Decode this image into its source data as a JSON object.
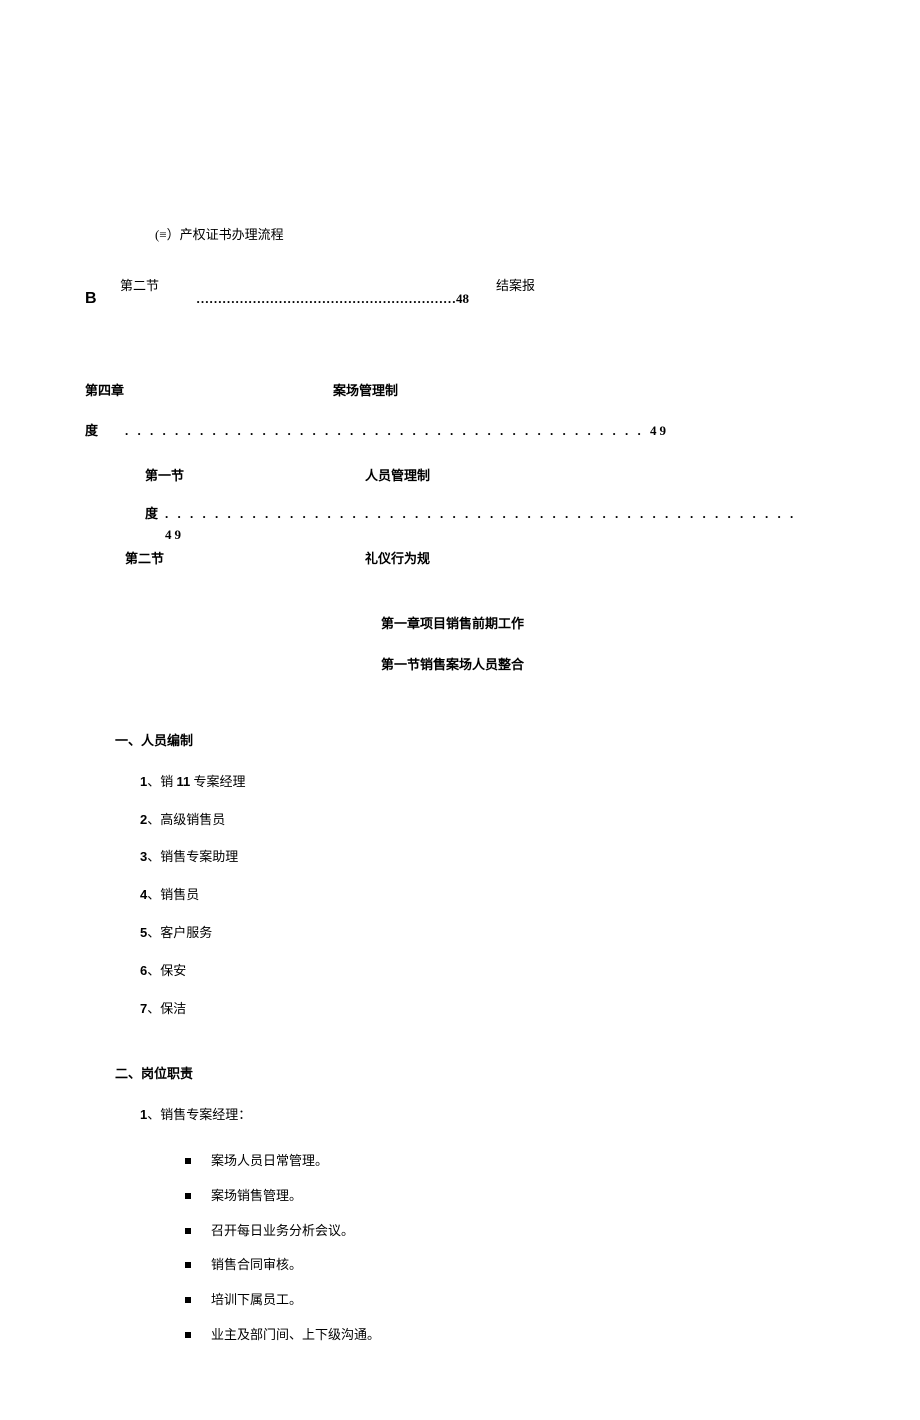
{
  "toc": {
    "item1": "(≡）产权证书办理流程",
    "sec2_label": "第二节",
    "sec2_tail": "结案报",
    "b_letter": "B",
    "b_dots": "……………………………………………………48",
    "ch4": "第四章",
    "ch4_title": "案场管理制",
    "ch4_du": "度",
    "ch4_dots": ". . . . . . . . . . . . . . . . . . . . . . . . . . . . . . . . . . . . . . . . . . 49",
    "ch4_sec1": "第一节",
    "ch4_sec1_title": "人员管理制",
    "ch4_sec1_du": "度",
    "ch4_sec1_dots": ". . . . . . . . . . . . . . . . . . . . . . . . . . . . . . . . . . . . . . . . . . . . . . . . . . . 49",
    "ch4_sec2": "第二节",
    "ch4_sec2_title": "礼仪行为规"
  },
  "body": {
    "chapter_heading": "第一章项目销售前期工作",
    "section_heading": "第一节销售案场人员整合",
    "section1": {
      "title": "一、人员编制",
      "items": [
        {
          "num": "1",
          "pre": "、销 ",
          "bold": "11",
          "post": " 专案经理"
        },
        {
          "num": "2",
          "pre": "、高级销售员"
        },
        {
          "num": "3",
          "pre": "、销售专案助理"
        },
        {
          "num": "4",
          "pre": "、销售员"
        },
        {
          "num": "5",
          "pre": "、客户服务"
        },
        {
          "num": "6",
          "pre": "、保安"
        },
        {
          "num": "7",
          "pre": "、保洁"
        }
      ]
    },
    "section2": {
      "title": "二、岗位职责",
      "lead": {
        "num": "1",
        "text": "、销售专案经理："
      },
      "bullets": [
        "案场人员日常管理。",
        "案场销售管理。",
        "召开每日业务分析会议。",
        "销售合同审核。",
        "培训下属员工。",
        "业主及部门间、上下级沟通。"
      ]
    }
  }
}
